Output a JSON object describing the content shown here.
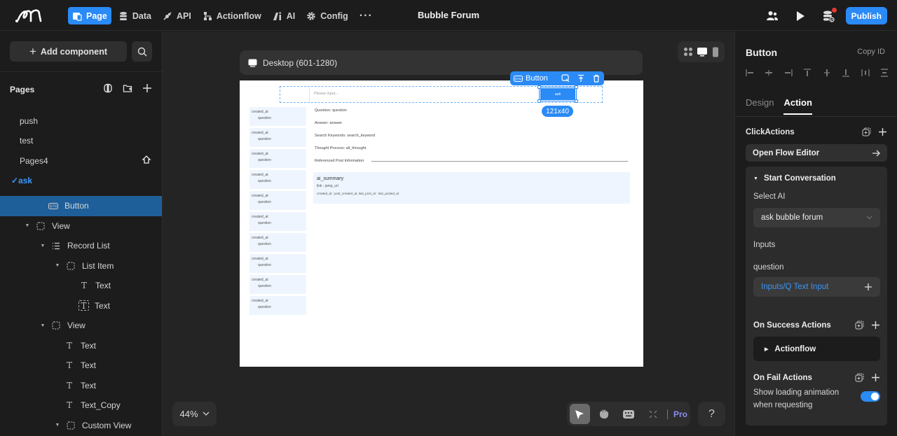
{
  "app": {
    "title": "Bubble Forum",
    "nav": [
      {
        "label": "Page",
        "icon": "page-icon",
        "active": true
      },
      {
        "label": "Data",
        "icon": "database-icon"
      },
      {
        "label": "API",
        "icon": "api-plug-icon"
      },
      {
        "label": "Actionflow",
        "icon": "actionflow-icon"
      },
      {
        "label": "AI",
        "icon": "ai-icon"
      },
      {
        "label": "Config",
        "icon": "gear-icon"
      },
      {
        "label": "···",
        "icon": "more-icon"
      }
    ],
    "publish_label": "Publish",
    "colors": {
      "accent": "#2a8af6",
      "notification": "#e53935",
      "selected_row": "#1f5f99",
      "pro": "#8a8df0"
    }
  },
  "left_panel": {
    "add_component_label": "Add component",
    "pages_heading": "Pages",
    "pages": [
      {
        "label": "push"
      },
      {
        "label": "test"
      },
      {
        "label": "Pages4",
        "home": true
      },
      {
        "label": "ask",
        "active": true,
        "check": "✓"
      }
    ],
    "tree": [
      {
        "label": "Button",
        "icon": "button-icon",
        "selected": true
      },
      {
        "label": "View",
        "icon": "view-icon",
        "caret": "▼"
      },
      {
        "label": "Record List",
        "icon": "list-icon",
        "caret": "▼"
      },
      {
        "label": "List Item",
        "icon": "view-icon",
        "caret": "▼"
      },
      {
        "label": "Text",
        "icon": "text-icon"
      },
      {
        "label": "Text",
        "icon": "text-bound-icon"
      },
      {
        "label": "View",
        "icon": "view-icon",
        "caret": "▼"
      },
      {
        "label": "Text",
        "icon": "text-icon"
      },
      {
        "label": "Text",
        "icon": "text-icon"
      },
      {
        "label": "Text",
        "icon": "text-icon"
      },
      {
        "label": "Text_Copy",
        "icon": "text-icon"
      },
      {
        "label": "Custom View",
        "icon": "view-icon",
        "caret": "▼"
      }
    ]
  },
  "canvas": {
    "device_label": "Desktop (601-1280)",
    "zoom_level": "44%",
    "pro_label": "Pro",
    "help_label": "?",
    "selection": {
      "label": "Button",
      "size": "121x40"
    },
    "preview": {
      "input_placeholder": "Please input...",
      "ask_button": "ask",
      "list_items": [
        {
          "created": "created_at",
          "question": "question"
        },
        {
          "created": "created_at",
          "question": "question"
        },
        {
          "created": "created_at",
          "question": "question"
        },
        {
          "created": "created_at",
          "question": "question"
        },
        {
          "created": "created_at",
          "question": "question"
        },
        {
          "created": "created_at",
          "question": "question"
        },
        {
          "created": "created_at",
          "question": "question"
        },
        {
          "created": "created_at",
          "question": "question"
        },
        {
          "created": "created_at",
          "question": "question"
        },
        {
          "created": "created_at",
          "question": "question"
        }
      ],
      "details": [
        "Question: question",
        "Answer: answer",
        "Search Keywords: search_keyword",
        "Thought Process: all_throught",
        "Referenced Post Information:"
      ],
      "summary": {
        "title": "ai_summary",
        "link": "link : jump_url",
        "meta": "created_at : post_created_at, last_post_at : last_posted_at"
      }
    }
  },
  "right_panel": {
    "title": "Button",
    "copy_id": "Copy ID",
    "tabs": [
      {
        "label": "Design"
      },
      {
        "label": "Action",
        "active": true
      }
    ],
    "click_actions_heading": "ClickActions",
    "open_flow_editor": "Open Flow Editor",
    "action": {
      "title": "Start Conversation",
      "select_ai_label": "Select AI",
      "select_ai_value": "ask bubble forum",
      "inputs_label": "Inputs",
      "input_name": "question",
      "input_binding": "Inputs/Q Text Input",
      "on_success_heading": "On Success Actions",
      "success_flow": "Actionflow",
      "on_fail_heading": "On Fail Actions",
      "loading_label_1": "Show loading animation",
      "loading_label_2": "when requesting",
      "loading_enabled": true
    }
  }
}
